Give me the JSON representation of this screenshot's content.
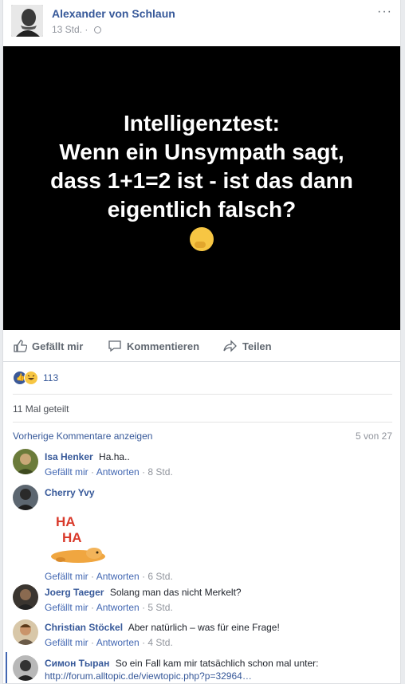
{
  "post": {
    "author": "Alexander von Schlaun",
    "time": "13 Std.",
    "separator": "·",
    "more": "···",
    "image_text": "Intelligenztest:\nWenn ein Unsympath sagt,\ndass 1+1=2 ist - ist das dann\neigentlich falsch?"
  },
  "actions": {
    "like": "Gefällt mir",
    "comment": "Kommentieren",
    "share": "Teilen"
  },
  "reactions": {
    "count": "113"
  },
  "shares": "11 Mal geteilt",
  "comments_header": {
    "prev": "Vorherige Kommentare anzeigen",
    "count": "5 von 27"
  },
  "comment_actions": {
    "like": "Gefällt mir",
    "reply": "Antworten",
    "dot": "·"
  },
  "comments": [
    {
      "name": "Isa Henker",
      "text": "Ha.ha..",
      "time": "8 Std."
    },
    {
      "name": "Cherry Yvy",
      "text": "",
      "time": "6 Std.",
      "sticker": "HA HA"
    },
    {
      "name": "Joerg Taeger",
      "text": "Solang man das nicht Merkelt?",
      "time": "5 Std."
    },
    {
      "name": "Christian Stöckel",
      "text": "Aber natürlich – was für eine Frage!",
      "time": "4 Std."
    },
    {
      "name": "Симон Тыран",
      "text": "So ein Fall kam mir tatsächlich schon mal unter:",
      "link": "http://forum.alltopic.de/viewtopic.php?p=32964…"
    }
  ],
  "colors": {
    "link": "#365899",
    "meta": "#90949c",
    "image_bg": "#000000"
  }
}
